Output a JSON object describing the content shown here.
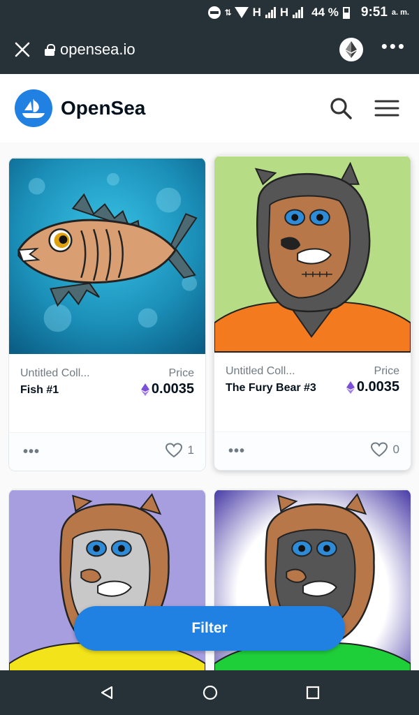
{
  "status_bar": {
    "network_1": "H",
    "network_2": "H",
    "battery": "44 %",
    "time": "9:51",
    "ampm": "a. m."
  },
  "browser": {
    "url": "opensea.io"
  },
  "site": {
    "brand": "OpenSea"
  },
  "cards": [
    {
      "collection": "Untitled Coll...",
      "name": "Fish #1",
      "price_label": "Price",
      "price": "0.0035",
      "likes": "1"
    },
    {
      "collection": "Untitled Coll...",
      "name": "The Fury Bear #3",
      "price_label": "Price",
      "price": "0.0035",
      "likes": "0"
    },
    {
      "collection": "",
      "name": "",
      "price_label": "",
      "price": "",
      "likes": ""
    },
    {
      "collection": "",
      "name": "",
      "price_label": "",
      "price": "",
      "likes": ""
    }
  ],
  "filter": {
    "label": "Filter"
  },
  "colors": {
    "accent": "#2081e2",
    "dark_bar": "#263238",
    "text_primary": "#04111d",
    "text_secondary": "#707a83",
    "eth_purple": "#7b4fd8"
  },
  "icons": [
    "close-icon",
    "lock-icon",
    "ethereum-icon",
    "more-icon",
    "opensea-logo-icon",
    "search-icon",
    "menu-icon",
    "heart-icon",
    "back-icon",
    "home-icon",
    "recents-icon"
  ]
}
